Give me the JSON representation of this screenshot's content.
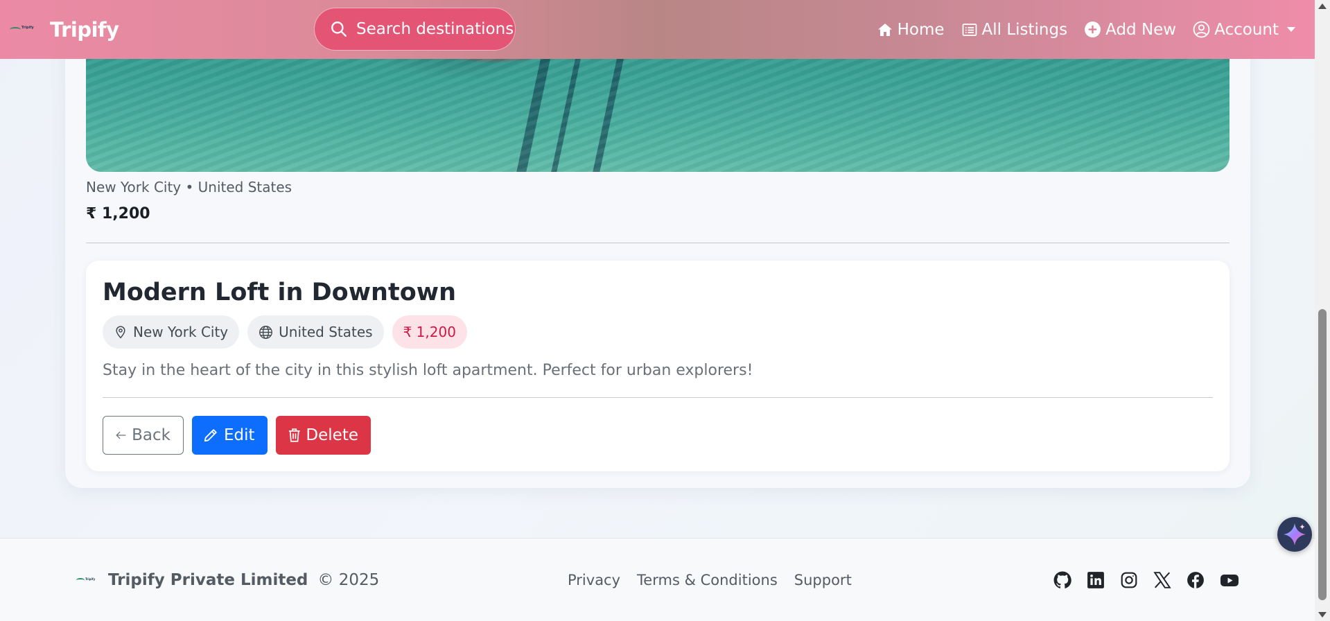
{
  "navbar": {
    "brand": "Tripify",
    "logo_text": "Tripify",
    "search_label": "Search destinations",
    "links": [
      {
        "label": "Home",
        "icon": "home-icon"
      },
      {
        "label": "All Listings",
        "icon": "list-icon"
      },
      {
        "label": "Add New",
        "icon": "plus-circle-icon"
      },
      {
        "label": "Account",
        "icon": "user-circle-icon"
      }
    ],
    "gradient_accent": "#e45575"
  },
  "listing_preview": {
    "location_line": "New York City • United States",
    "price": "₹ 1,200"
  },
  "detail": {
    "title": "Modern Loft in Downtown",
    "city": "New York City",
    "country": "United States",
    "price": "₹ 1,200",
    "description": "Stay in the heart of the city in this stylish loft apartment. Perfect for urban explorers!",
    "buttons": {
      "back": "Back",
      "edit": "Edit",
      "delete": "Delete"
    }
  },
  "footer": {
    "logo_text": "Tripify",
    "company": "Tripify Private Limited",
    "copyright": "© 2025",
    "links": [
      "Privacy",
      "Terms & Conditions",
      "Support"
    ],
    "social": [
      "github-icon",
      "linkedin-icon",
      "instagram-icon",
      "x-icon",
      "facebook-icon",
      "youtube-icon"
    ]
  },
  "colors": {
    "primary": "#0d6efd",
    "danger": "#dc3545",
    "price_chip_text": "#d0173f",
    "price_chip_bg": "#fde3e8"
  }
}
